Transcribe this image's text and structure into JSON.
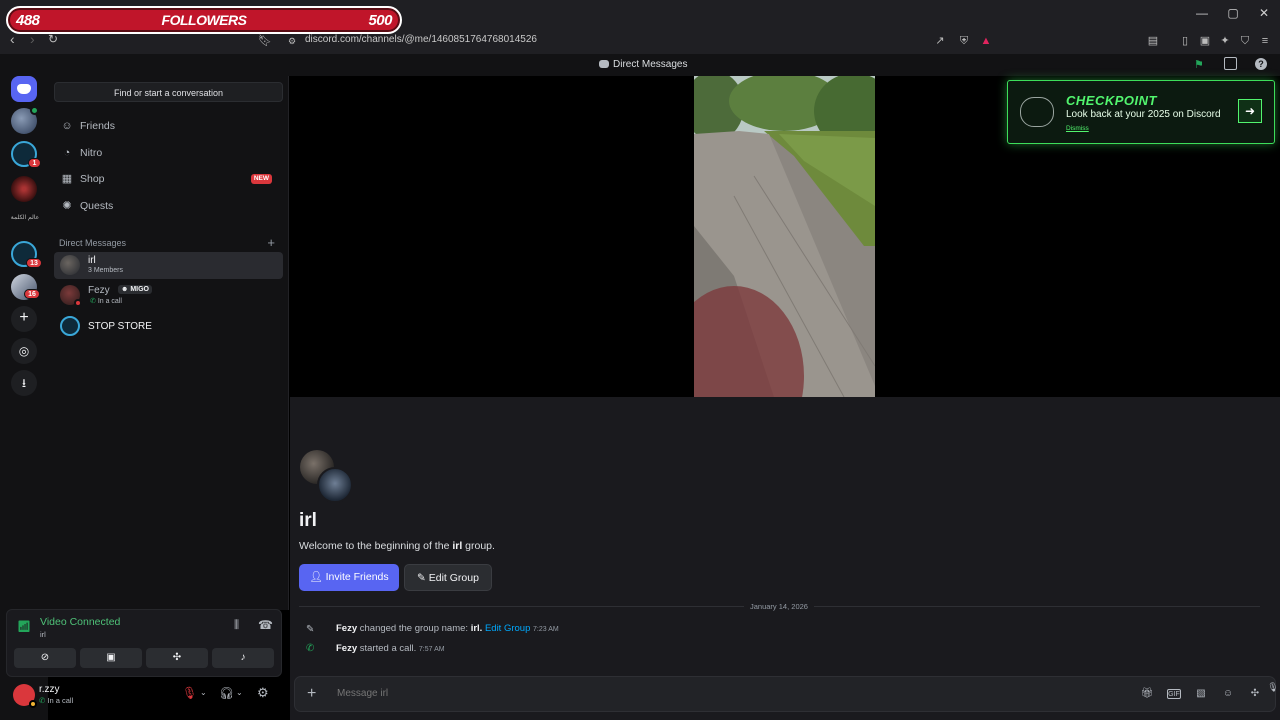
{
  "overlay": {
    "followers_current": "488",
    "followers_label": "FOLLOWERS",
    "followers_goal": "500"
  },
  "browser": {
    "url": "discord.com/channels/@me/1460851764768014526",
    "window_controls": [
      "—",
      "▢",
      "✕"
    ]
  },
  "titlebar": {
    "label": "Direct Messages"
  },
  "rail": {
    "badges": [
      "1",
      "13",
      "16"
    ],
    "server_text": "عالم الكلمة"
  },
  "sidebar": {
    "search_placeholder": "Find or start a conversation",
    "nav": [
      {
        "label": "Friends",
        "icon": "friends-icon"
      },
      {
        "label": "Nitro",
        "icon": "nitro-icon"
      },
      {
        "label": "Shop",
        "icon": "shop-icon",
        "badge": "NEW"
      },
      {
        "label": "Quests",
        "icon": "quests-icon"
      }
    ],
    "dm_header": "Direct Messages",
    "dms": [
      {
        "name": "irl",
        "sub": "3 Members",
        "active": true
      },
      {
        "name": "Fezy",
        "tag": "MIGO",
        "sub": "In a call"
      },
      {
        "name": "STOP STORE"
      }
    ]
  },
  "voice": {
    "title": "Video Connected",
    "channel": "irl"
  },
  "user": {
    "name": "r.zzy",
    "status": "In a call"
  },
  "banner": {
    "title": "CHECKPOINT",
    "subtitle": "Look back at your 2025 on Discord",
    "dismiss": "Dismiss"
  },
  "main": {
    "group_title": "irl",
    "welcome_prefix": "Welcome to the beginning of the ",
    "welcome_name": "irl",
    "welcome_suffix": " group.",
    "invite_label": "Invite Friends",
    "edit_label": "Edit Group",
    "date_divider": "January 14, 2026",
    "messages": [
      {
        "user": "Fezy",
        "text": " changed the group name: ",
        "value": "irl.",
        "link": "Edit Group",
        "time": "7:23 AM"
      },
      {
        "user": "Fezy",
        "text": " started a call.",
        "time": "7:57 AM"
      }
    ],
    "composer_placeholder": "Message irl"
  },
  "colors": {
    "accent": "#5865f2",
    "online": "#23a55a",
    "danger": "#da373c",
    "checkpoint": "#52f56e"
  }
}
